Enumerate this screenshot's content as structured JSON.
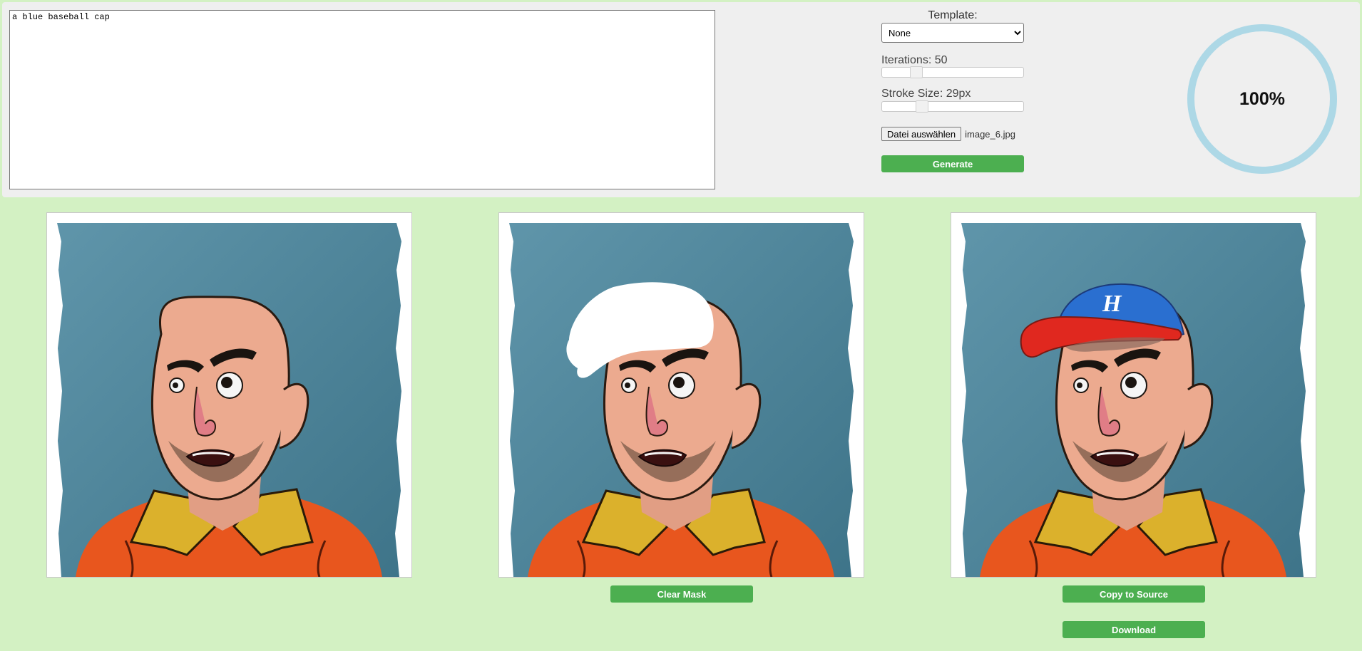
{
  "prompt": {
    "text": "a blue baseball cap"
  },
  "controls": {
    "template_label": "Template:",
    "template_options": [
      "None"
    ],
    "template_selected": "None",
    "iterations_label": "Iterations: 50",
    "iterations_value": 50,
    "stroke_label": "Stroke Size: 29px",
    "stroke_value": 29,
    "file_button_label": "Datei auswählen",
    "file_name": "image_6.jpg",
    "generate_label": "Generate"
  },
  "progress": {
    "percent": 100,
    "text": "100%",
    "ring_color": "#add8e6"
  },
  "images": {
    "mask_button_label": "Clear Mask",
    "copy_button_label": "Copy to Source",
    "download_button_label": "Download",
    "cap_letter": "H"
  },
  "colors": {
    "page_background": "#d3f1c3",
    "panel_background": "#efefef",
    "button": "#4caf50",
    "artwork_background": "#4d8197",
    "skin": "#ecaa8f",
    "shirt": "#e8561e",
    "collar": "#dbb12c",
    "cap_blue": "#2a6fd0",
    "cap_red": "#e0281f"
  }
}
